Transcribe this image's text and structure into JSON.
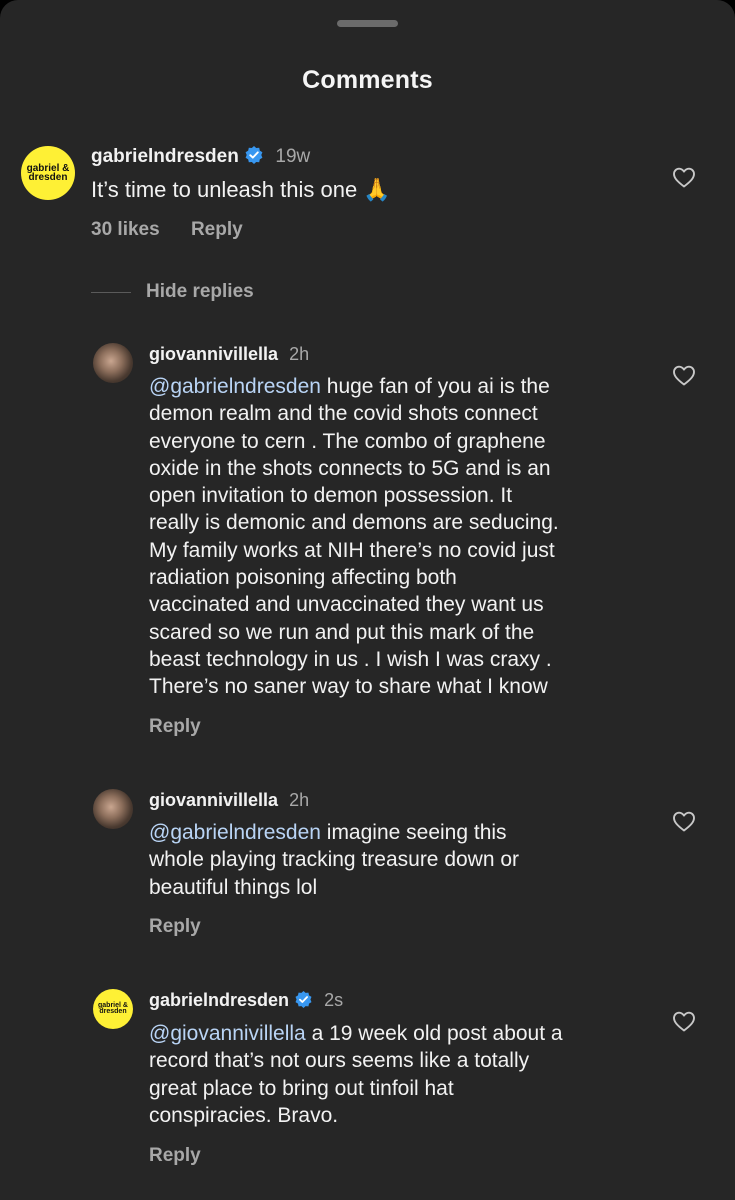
{
  "sheet_title": "Comments",
  "main_comment": {
    "username": "gabrielndresden",
    "time": "19w",
    "text": "It’s time to unleash this one 🙏",
    "likes": "30 likes",
    "reply": "Reply",
    "avatar_text": [
      "gabriel &",
      "dresden"
    ]
  },
  "hide_replies": "Hide replies",
  "replies": [
    {
      "username": "giovannivillella",
      "time": "2h",
      "mention": "@gabrielndresden",
      "text": " huge fan of you ai is the\ndemon realm and the covid shots connect\neveryone to cern . The combo of graphene\noxide in the shots connects to 5G and is an\nopen invitation to demon possession. It\nreally is demonic and demons are seducing.\nMy family works at NIH there’s no covid just\nradiation poisoning affecting both\nvaccinated and unvaccinated they want us\nscared so we run and put this mark of the\nbeast technology in us . I wish I was craxy .\nThere’s no saner way to share what I know",
      "reply": "Reply"
    },
    {
      "username": "giovannivillella",
      "time": "2h",
      "mention": "@gabrielndresden",
      "text": " imagine seeing this\nwhole playing tracking treasure down or\nbeautiful things lol",
      "reply": "Reply"
    },
    {
      "username": "gabrielndresden",
      "time": "2s",
      "mention": "@giovannivillella",
      "text": " a 19 week old post about a\nrecord that’s not ours seems like a totally\ngreat place to bring out tinfoil hat\nconspiracies. Bravo.",
      "reply": "Reply",
      "avatar_text": [
        "gabriel &",
        "dresden"
      ]
    }
  ],
  "colors": {
    "background": "#262626",
    "text": "#f2f2f2",
    "muted": "#a8a8a8",
    "mention": "#b9d4f5",
    "verified": "#3897f0",
    "brand_avatar": "#fef035"
  }
}
